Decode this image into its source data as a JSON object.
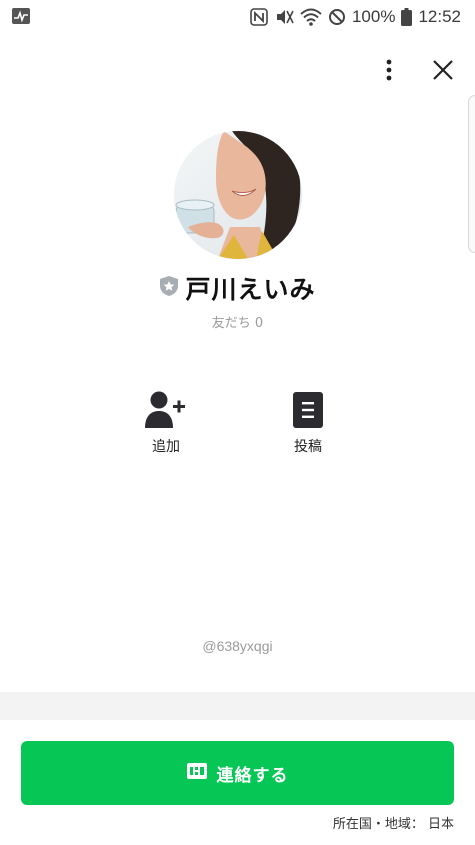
{
  "status_bar": {
    "battery": "100%",
    "time": "12:52",
    "icons": [
      "activity-icon",
      "nfc-icon",
      "vibrate-icon",
      "wifi-icon",
      "blocked-icon",
      "battery-icon"
    ]
  },
  "header": {
    "icons": [
      "more-vertical-icon",
      "close-icon"
    ]
  },
  "profile": {
    "name": "戸川えいみ",
    "badge_icon": "shield-star-icon",
    "friends_label": "友だち 0"
  },
  "actions": [
    {
      "label": "追加",
      "icon": "add-friend-icon"
    },
    {
      "label": "投稿",
      "icon": "post-document-icon"
    }
  ],
  "line_id": "@638yxqgi",
  "contact_button": {
    "label": "連絡する",
    "icon": "chat-icon"
  },
  "region": "所在国・地域： 日本",
  "colors": {
    "accent": "#06c755",
    "text": "#111111",
    "muted": "#9a9a9a"
  }
}
